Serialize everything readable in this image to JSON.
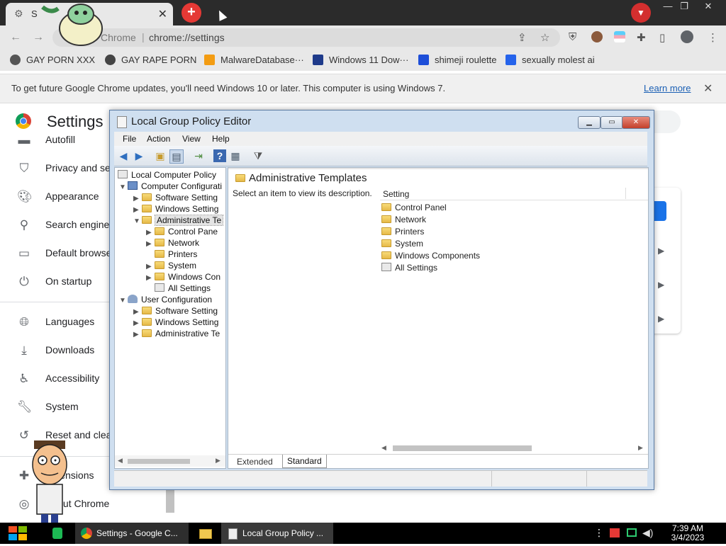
{
  "chrome": {
    "tab_title": "S",
    "address": {
      "site_label": "Chrome",
      "separator": "|",
      "url": "chrome://settings"
    },
    "bookmarks": [
      {
        "label": "GAY PORN XXX",
        "color": "#555555"
      },
      {
        "label": "GAY RAPE PORN",
        "color": "#444444"
      },
      {
        "label": "MalwareDatabase···",
        "color": "#f39c12"
      },
      {
        "label": "Windows 11 Dow···",
        "color": "#1e3a8a"
      },
      {
        "label": "shimeji roulette",
        "color": "#1d4ed8"
      },
      {
        "label": "sexually molest ai",
        "color": "#2563eb"
      }
    ],
    "infobar": {
      "message": "To get future Google Chrome updates, you'll need Windows 10 or later. This computer is using Windows 7.",
      "link": "Learn more"
    }
  },
  "settings": {
    "title": "Settings",
    "sidebar": [
      {
        "label": "Autofill",
        "icon": "autofill-icon"
      },
      {
        "label": "Privacy and se",
        "icon": "shield-icon"
      },
      {
        "label": "Appearance",
        "icon": "palette-icon"
      },
      {
        "label": "Search engine",
        "icon": "search-icon"
      },
      {
        "label": "Default browse",
        "icon": "browser-icon"
      },
      {
        "label": "On startup",
        "icon": "power-icon"
      },
      {
        "label": "Languages",
        "icon": "globe-icon"
      },
      {
        "label": "Downloads",
        "icon": "download-icon"
      },
      {
        "label": "Accessibility",
        "icon": "accessibility-icon"
      },
      {
        "label": "System",
        "icon": "wrench-icon"
      },
      {
        "label": "Reset and clea",
        "icon": "reset-icon"
      },
      {
        "label": "Extensions",
        "icon": "puzzle-icon"
      },
      {
        "label": "About Chrome",
        "icon": "chrome-icon"
      }
    ]
  },
  "gpe": {
    "title": "Local Group Policy Editor",
    "menu": [
      "File",
      "Action",
      "View",
      "Help"
    ],
    "tree": {
      "root": "Local Computer Policy",
      "computer": "Computer Configurati",
      "software": "Software Setting",
      "windows": "Windows Setting",
      "admin": "Administrative Te",
      "control_panel": "Control Pane",
      "network": "Network",
      "printers": "Printers",
      "system": "System",
      "win_components": "Windows Con",
      "all_settings": "All Settings",
      "user": "User Configuration",
      "u_software": "Software Setting",
      "u_windows": "Windows Setting",
      "u_admin": "Administrative Te"
    },
    "content": {
      "header": "Administrative Templates",
      "description": "Select an item to view its description.",
      "column": "Setting",
      "items": [
        "Control Panel",
        "Network",
        "Printers",
        "System",
        "Windows Components",
        "All Settings"
      ]
    },
    "tabs": {
      "extended": "Extended",
      "standard": "Standard"
    }
  },
  "taskbar": {
    "items": [
      "Settings - Google C...",
      "Local Group Policy ..."
    ],
    "time": "7:39 AM",
    "date": "3/4/2023"
  }
}
